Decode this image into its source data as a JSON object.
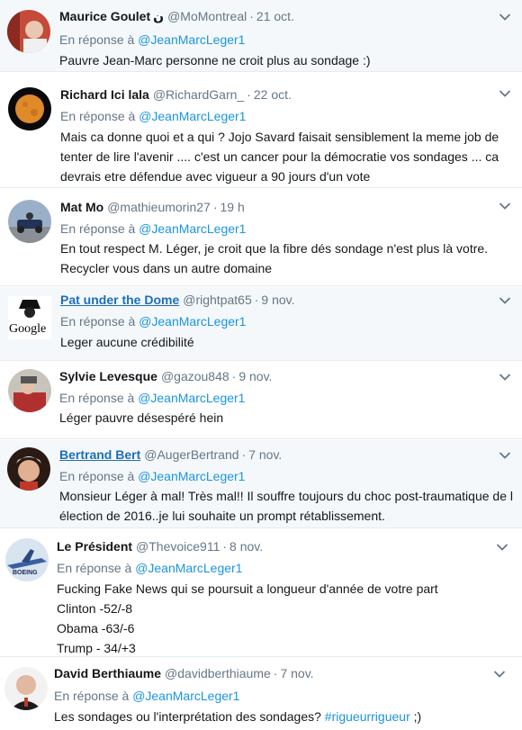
{
  "reply_prefix": "En réponse à",
  "tweets": [
    {
      "display_name": "Maurice Goulet",
      "name_symbol": "ن",
      "handle": "@MoMontreal",
      "time": "21 oct.",
      "reply_to": "@JeanMarcLeger1",
      "text_lines": [
        "Pauvre Jean-Marc  personne ne croit plus au sondage  :)"
      ]
    },
    {
      "display_name": "Richard Ici lala",
      "handle": "@RichardGarn_",
      "time": "22 oct.",
      "reply_to": "@JeanMarcLeger1",
      "text_lines": [
        "Mais ca donne quoi et a qui ?  Jojo Savard faisait sensiblement la meme job de",
        "tenter de lire l'avenir ....   c'est un cancer pour la démocratie vos sondages ... ca",
        "devrais etre défendue avec vigueur a 90 jours d'un vote"
      ]
    },
    {
      "display_name": "Mat Mo",
      "handle": "@mathieumorin27",
      "time": "19 h",
      "reply_to": "@JeanMarcLeger1",
      "text_lines": [
        "En tout respect M. Léger, je croit que la fibre dés sondage n'est plus là votre.",
        "Recycler vous dans un autre domaine"
      ]
    },
    {
      "display_name": "Pat under the Dome",
      "handle": "@rightpat65",
      "time": "9 nov.",
      "reply_to": "@JeanMarcLeger1",
      "text_lines": [
        "Leger aucune crédibilité"
      ],
      "avatar_text": "Google"
    },
    {
      "display_name": "Sylvie Levesque",
      "handle": "@gazou848",
      "time": "9 nov.",
      "reply_to": "@JeanMarcLeger1",
      "text_lines": [
        "Léger pauvre  désespéré  hein"
      ]
    },
    {
      "display_name": "Bertrand Bert",
      "handle": "@AugerBertrand",
      "time": "7 nov.",
      "reply_to": "@JeanMarcLeger1",
      "text_lines": [
        "Monsieur Léger à mal! Très mal!! Il souffre toujours du choc post-traumatique de l",
        "élection de 2016..je lui souhaite un prompt rétablissement."
      ]
    },
    {
      "display_name": "Le Président",
      "handle": "@Thevoice911",
      "time": "8 nov.",
      "reply_to": "@JeanMarcLeger1",
      "text_lines": [
        "Fucking Fake News qui se poursuit a longueur d'année  de votre part",
        "Clinton -52/-8",
        "Obama -63/-6",
        "Trump - 34/+3"
      ],
      "avatar_text": "BOEING"
    },
    {
      "display_name": "David Berthiaume",
      "handle": "@davidberthiaume",
      "time": "7 nov.",
      "reply_to": "@JeanMarcLeger1",
      "text_main": "Les sondages ou l'interprétation des sondages? ",
      "hashtag": "#rigueurrigueur",
      "text_tail": " ;)"
    }
  ]
}
